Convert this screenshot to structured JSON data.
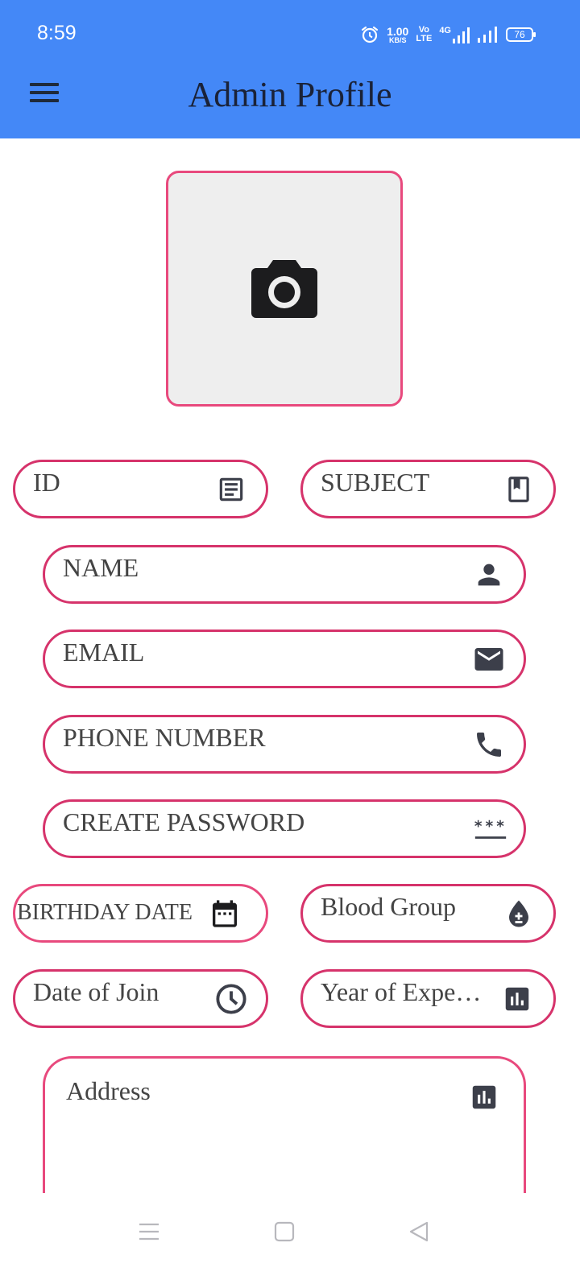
{
  "status_bar": {
    "time": "8:59",
    "network_speed": "1.00",
    "network_speed_unit": "KB/S",
    "volte_line1": "Vo",
    "volte_line2": "LTE",
    "network_type": "4G",
    "battery": "76"
  },
  "app_bar": {
    "title": "Admin Profile",
    "background_color": "#4488f7"
  },
  "photo_picker": {
    "icon": "camera-icon"
  },
  "form": {
    "id": {
      "label": "ID",
      "icon": "article-icon"
    },
    "subject": {
      "label": "SUBJECT",
      "icon": "book-icon"
    },
    "name": {
      "label": "NAME",
      "icon": "person-icon"
    },
    "email": {
      "label": "EMAIL",
      "icon": "mail-icon"
    },
    "phone": {
      "label": "PHONE NUMBER",
      "icon": "phone-icon"
    },
    "password": {
      "label": "CREATE PASSWORD",
      "icon": "password-icon"
    },
    "birthday": {
      "label": "BIRTHDAY DATE",
      "icon": "calendar-icon"
    },
    "blood_group": {
      "label": "Blood Group",
      "icon": "blood-drop-icon"
    },
    "date_of_join": {
      "label": "Date of Join",
      "icon": "clock-icon"
    },
    "experience": {
      "label": "Year of Expe…",
      "icon": "bar-chart-icon"
    },
    "address": {
      "label": "Address",
      "icon": "bar-chart-icon"
    }
  },
  "colors": {
    "field_border": "#d6336b",
    "photo_border": "#e8497d",
    "icon": "#3c3f4a"
  },
  "nav_bar": {
    "items": [
      "menu-icon",
      "home-square-icon",
      "back-triangle-icon"
    ]
  }
}
